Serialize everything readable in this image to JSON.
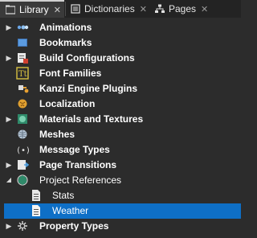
{
  "tabs": [
    {
      "label": "Library",
      "icon": "library-icon",
      "active": true
    },
    {
      "label": "Dictionaries",
      "icon": "dictionaries-icon",
      "active": false
    },
    {
      "label": "Pages",
      "icon": "pages-icon",
      "active": false
    }
  ],
  "close_glyph": "✕",
  "tree": {
    "items": [
      {
        "label": "Animations",
        "icon": "animations-icon",
        "expander": "collapsed"
      },
      {
        "label": "Bookmarks",
        "icon": "bookmarks-icon",
        "expander": "none"
      },
      {
        "label": "Build Configurations",
        "icon": "build-configurations-icon",
        "expander": "collapsed"
      },
      {
        "label": "Font Families",
        "icon": "font-families-icon",
        "expander": "none"
      },
      {
        "label": "Kanzi Engine Plugins",
        "icon": "kanzi-engine-plugins-icon",
        "expander": "none"
      },
      {
        "label": "Localization",
        "icon": "localization-icon",
        "expander": "none"
      },
      {
        "label": "Materials and Textures",
        "icon": "materials-and-textures-icon",
        "expander": "collapsed"
      },
      {
        "label": "Meshes",
        "icon": "meshes-icon",
        "expander": "none"
      },
      {
        "label": "Message Types",
        "icon": "message-types-icon",
        "expander": "none"
      },
      {
        "label": "Page Transitions",
        "icon": "page-transitions-icon",
        "expander": "collapsed"
      },
      {
        "label": "Project References",
        "icon": "project-references-icon",
        "expander": "expanded"
      },
      {
        "label": "Stats",
        "icon": "document-icon",
        "expander": "none",
        "child": true
      },
      {
        "label": "Weather",
        "icon": "document-icon",
        "expander": "none",
        "child": true,
        "selected": true
      },
      {
        "label": "Property Types",
        "icon": "property-types-icon",
        "expander": "collapsed"
      }
    ]
  },
  "colors": {
    "background": "#2c2c2c",
    "tab_bar": "#232323",
    "active_tab": "#3a3a3a",
    "selection": "#0e6fc6",
    "text": "#ffffff"
  }
}
